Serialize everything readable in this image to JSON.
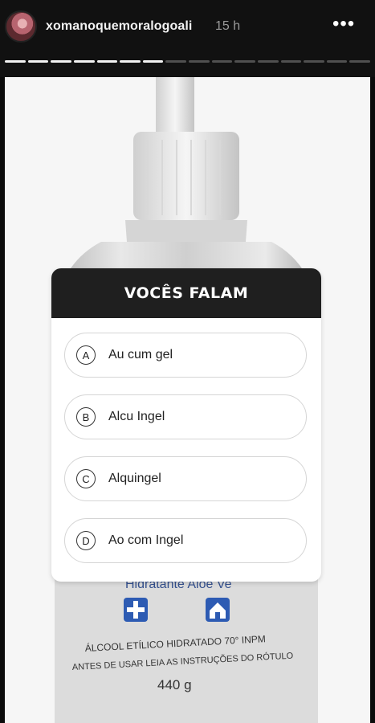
{
  "header": {
    "username": "xomanoquemoralogoali",
    "time": "15 h",
    "more_icon": "more-horizontal-icon"
  },
  "progress": {
    "total_segments": 16,
    "current_index": 6
  },
  "background_image": {
    "bottle_label_line1": "Hidratante Aloe Ve",
    "bottle_label_line2": "ÁLCOOL ETÍLICO HIDRATADO 70° INPM",
    "bottle_label_line3": "ANTES DE USAR LEIA AS INSTRUÇÕES DO RÓTULO",
    "bottle_weight": "440 g"
  },
  "poll": {
    "title": "VOCÊS FALAM",
    "options": [
      {
        "letter": "A",
        "text": "Au cum gel"
      },
      {
        "letter": "B",
        "text": "Alcu Ingel"
      },
      {
        "letter": "C",
        "text": "Alquingel"
      },
      {
        "letter": "D",
        "text": "Ao com Ingel"
      }
    ]
  },
  "colors": {
    "header_bg": "#111111",
    "poll_header_bg": "#1f1f1f",
    "option_border": "#d5d5d5"
  }
}
